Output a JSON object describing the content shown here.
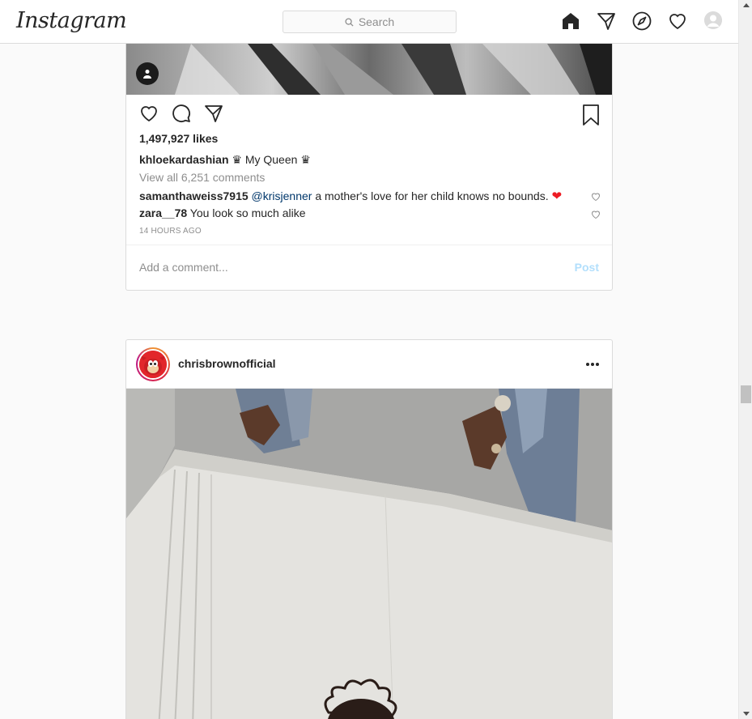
{
  "app": {
    "logo": "Instagram"
  },
  "search": {
    "placeholder": "Search"
  },
  "nav": {
    "icons": [
      "home-icon",
      "direct-icon",
      "explore-icon",
      "activity-icon",
      "profile-icon"
    ]
  },
  "post1": {
    "likes": "1,497,927 likes",
    "caption_user": "khloekardashian",
    "caption_text": " ♛ My Queen ♛",
    "view_all": "View all 6,251 comments",
    "comments": [
      {
        "user": "samanthaweiss7915",
        "mention": "@krisjenner",
        "text": " a mother's love for her child knows no bounds. ",
        "emoji": "❤"
      },
      {
        "user": "zara__78",
        "mention": "",
        "text": " You look so much alike",
        "emoji": ""
      }
    ],
    "timestamp": "14 HOURS AGO",
    "add_comment_placeholder": "Add a comment...",
    "post_label": "Post"
  },
  "post2": {
    "username": "chrisbrownofficial"
  },
  "colors": {
    "border": "#dbdbdb",
    "link": "#00376b",
    "post_disabled": "#b2dffc",
    "heart": "#ed4956"
  }
}
